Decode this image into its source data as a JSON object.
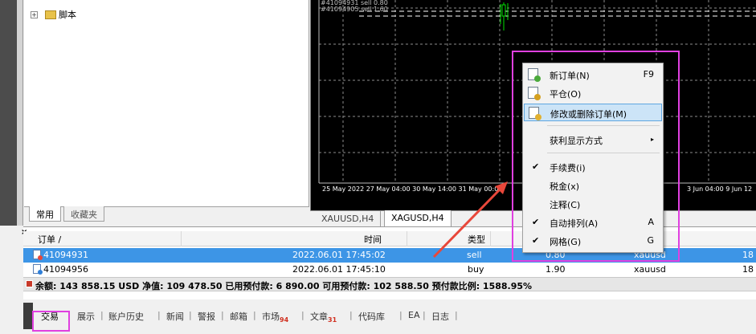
{
  "navigator": {
    "tree_item": "脚本",
    "tabs": [
      "常用",
      "收藏夹"
    ]
  },
  "chart": {
    "overlay_line1": "#41094931 sell 0.80",
    "overlay_line2": "#41094905 sell 1.60",
    "time_axis": "25 May 2022   27 May 04:00   30 May 14:00   31 May 00:00",
    "time_axis_right": "3 Jun 04:00    9 Jun 12",
    "tabs": [
      "XAUUSD,H4",
      "XAGUSD,H4"
    ]
  },
  "context_menu": {
    "items": [
      {
        "label": "新订单(N)",
        "shortcut": "F9"
      },
      {
        "label": "平仓(O)",
        "shortcut": ""
      },
      {
        "label": "修改或删除订单(M)",
        "shortcut": ""
      },
      {
        "label": "获利显示方式",
        "shortcut": "▸"
      },
      {
        "label": "手续费(i)",
        "shortcut": ""
      },
      {
        "label": "税金(x)",
        "shortcut": ""
      },
      {
        "label": "注释(C)",
        "shortcut": ""
      },
      {
        "label": "自动排列(A)",
        "shortcut": "A"
      },
      {
        "label": "网格(G)",
        "shortcut": "G"
      }
    ],
    "check": "✔"
  },
  "terminal": {
    "close_label": "×",
    "columns": {
      "order": "订单  /",
      "time": "时间",
      "type": "类型"
    },
    "rows": [
      {
        "order": "41094931",
        "time": "2022.06.01 17:45:02",
        "type": "sell",
        "volume": "0.80",
        "symbol": "xauusd",
        "price": "18"
      },
      {
        "order": "41094956",
        "time": "2022.06.01 17:45:10",
        "type": "buy",
        "volume": "1.90",
        "symbol": "xauusd",
        "price": "18"
      }
    ],
    "summary": "余额: 143 858.15 USD  净值: 109 478.50  已用预付款: 6 890.00  可用预付款: 102 588.50  预付款比例: 1588.95%"
  },
  "bottom_tabs": {
    "items": [
      "交易",
      "展示",
      "账户历史",
      "新闻",
      "警报",
      "邮箱",
      "市场",
      "文章",
      "代码库",
      "EA",
      "日志"
    ],
    "market_badge": "94",
    "article_badge": "31"
  },
  "colors": {
    "highlight_box": "#e040e0",
    "selected_row": "#3d95e6",
    "arrow": "#e8473a"
  }
}
